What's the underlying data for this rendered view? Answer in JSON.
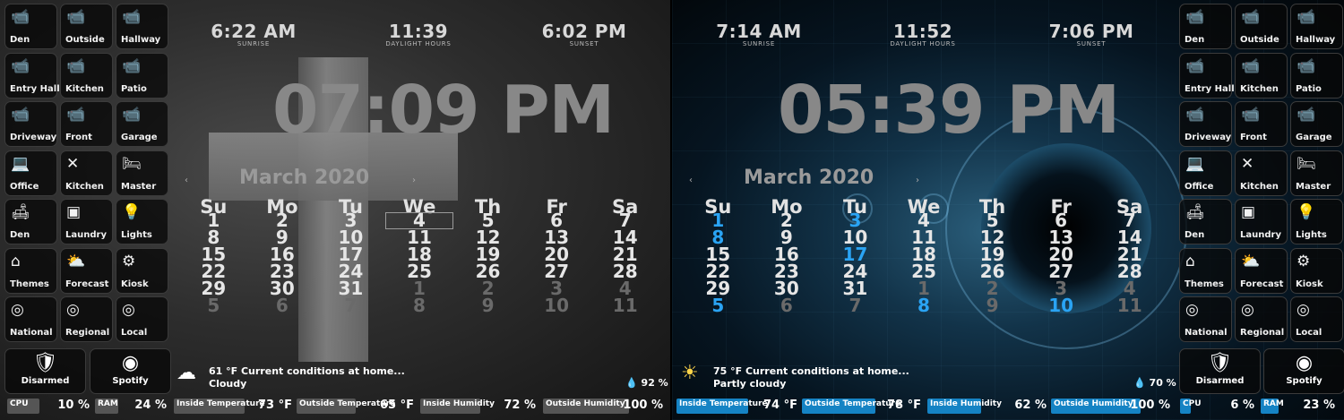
{
  "colors": {
    "accent_blue": "#1583c4",
    "accent_gray": "#555555",
    "today_blue": "#2aa4f4"
  },
  "left": {
    "tiles": [
      {
        "label": "Den",
        "icon": "camera-icon",
        "glyph": "📹"
      },
      {
        "label": "Outside",
        "icon": "camera-icon",
        "glyph": "📹"
      },
      {
        "label": "Hallway",
        "icon": "camera-icon",
        "glyph": "📹"
      },
      {
        "label": "Entry Hall",
        "icon": "camera-icon",
        "glyph": "📹"
      },
      {
        "label": "Kitchen",
        "icon": "camera-icon",
        "glyph": "📹"
      },
      {
        "label": "Patio",
        "icon": "camera-icon",
        "glyph": "📹"
      },
      {
        "label": "Driveway",
        "icon": "camera-icon",
        "glyph": "📹"
      },
      {
        "label": "Front",
        "icon": "camera-icon",
        "glyph": "📹"
      },
      {
        "label": "Garage",
        "icon": "camera-icon",
        "glyph": "📹"
      },
      {
        "label": "Office",
        "icon": "laptop-icon",
        "glyph": "💻"
      },
      {
        "label": "Kitchen",
        "icon": "utensils-icon",
        "glyph": "✕"
      },
      {
        "label": "Master",
        "icon": "bed-icon",
        "glyph": "🛏"
      },
      {
        "label": "Den",
        "icon": "sofa-icon",
        "glyph": "🛋"
      },
      {
        "label": "Laundry",
        "icon": "washer-icon",
        "glyph": "▣"
      },
      {
        "label": "Lights",
        "icon": "lightbulb-icon",
        "glyph": "💡"
      },
      {
        "label": "Themes",
        "icon": "home-palette-icon",
        "glyph": "⌂"
      },
      {
        "label": "Forecast",
        "icon": "weather-icon",
        "glyph": "⛅"
      },
      {
        "label": "Kiosk",
        "icon": "gear-icon",
        "glyph": "⚙"
      },
      {
        "label": "National",
        "icon": "radar-icon",
        "glyph": "◎"
      },
      {
        "label": "Regional",
        "icon": "radar-icon",
        "glyph": "◎"
      },
      {
        "label": "Local",
        "icon": "radar-icon",
        "glyph": "◎"
      }
    ],
    "disarmed": {
      "label": "Disarmed",
      "icon": "shield-check-icon",
      "glyph": "🛡"
    },
    "spotify": {
      "label": "Spotify",
      "icon": "spotify-icon",
      "glyph": "◉"
    },
    "sunrise": {
      "time": "6:22 AM",
      "label": "SUNRISE"
    },
    "daylight": {
      "time": "11:39",
      "label": "DAYLIGHT HOURS"
    },
    "sunset": {
      "time": "6:02 PM",
      "label": "SUNSET"
    },
    "clock": "07:09 PM",
    "calendar": {
      "title": "March 2020",
      "prev": "‹",
      "next": "›",
      "headers": [
        "Su",
        "Mo",
        "Tu",
        "We",
        "Th",
        "Fr",
        "Sa"
      ],
      "days": [
        "1",
        "2",
        "3",
        "4",
        "5",
        "6",
        "7",
        "8",
        "9",
        "10",
        "11",
        "12",
        "13",
        "14",
        "15",
        "16",
        "17",
        "18",
        "19",
        "20",
        "21",
        "22",
        "23",
        "24",
        "25",
        "26",
        "27",
        "28",
        "29",
        "30",
        "31",
        "1",
        "2",
        "3",
        "4",
        "5",
        "6",
        "7",
        "8",
        "9",
        "10",
        "11"
      ]
    },
    "weather": {
      "line1": "61 °F Current conditions at home...",
      "line2": "Cloudy",
      "icon": "cloud-icon",
      "glyph": "☁"
    },
    "humidity": "92 %",
    "status": [
      {
        "label": "CPU",
        "value": "10 %",
        "pct": 8
      },
      {
        "label": "RAM",
        "value": "24 %",
        "pct": 25
      },
      {
        "label": "Inside Temperature",
        "value": "73 °F",
        "pct": 82
      },
      {
        "label": "Outside Temperature",
        "value": "65 °F",
        "pct": 72
      },
      {
        "label": "Inside Humidity",
        "value": "72 %",
        "pct": 70
      },
      {
        "label": "Outside Humidity",
        "value": "100 %",
        "pct": 100
      }
    ]
  },
  "right": {
    "tiles": [
      {
        "label": "Den",
        "icon": "camera-icon",
        "glyph": "📹"
      },
      {
        "label": "Outside",
        "icon": "camera-icon",
        "glyph": "📹"
      },
      {
        "label": "Hallway",
        "icon": "camera-icon",
        "glyph": "📹"
      },
      {
        "label": "Entry Hall",
        "icon": "camera-icon",
        "glyph": "📹"
      },
      {
        "label": "Kitchen",
        "icon": "camera-icon",
        "glyph": "📹"
      },
      {
        "label": "Patio",
        "icon": "camera-icon",
        "glyph": "📹"
      },
      {
        "label": "Driveway",
        "icon": "camera-icon",
        "glyph": "📹"
      },
      {
        "label": "Front",
        "icon": "camera-icon",
        "glyph": "📹"
      },
      {
        "label": "Garage",
        "icon": "camera-icon",
        "glyph": "📹"
      },
      {
        "label": "Office",
        "icon": "laptop-icon",
        "glyph": "💻"
      },
      {
        "label": "Kitchen",
        "icon": "utensils-icon",
        "glyph": "✕"
      },
      {
        "label": "Master",
        "icon": "bed-icon",
        "glyph": "🛏"
      },
      {
        "label": "Den",
        "icon": "sofa-icon",
        "glyph": "🛋"
      },
      {
        "label": "Laundry",
        "icon": "washer-icon",
        "glyph": "▣"
      },
      {
        "label": "Lights",
        "icon": "lightbulb-icon",
        "glyph": "💡"
      },
      {
        "label": "Themes",
        "icon": "home-palette-icon",
        "glyph": "⌂"
      },
      {
        "label": "Forecast",
        "icon": "weather-icon",
        "glyph": "⛅"
      },
      {
        "label": "Kiosk",
        "icon": "gear-icon",
        "glyph": "⚙"
      },
      {
        "label": "National",
        "icon": "radar-icon",
        "glyph": "◎"
      },
      {
        "label": "Regional",
        "icon": "radar-icon",
        "glyph": "◎"
      },
      {
        "label": "Local",
        "icon": "radar-icon",
        "glyph": "◎"
      }
    ],
    "disarmed": {
      "label": "Disarmed",
      "icon": "shield-check-icon",
      "glyph": "🛡"
    },
    "spotify": {
      "label": "Spotify",
      "icon": "spotify-icon",
      "glyph": "◉"
    },
    "sunrise": {
      "time": "7:14 AM",
      "label": "SUNRISE"
    },
    "daylight": {
      "time": "11:52",
      "label": "DAYLIGHT HOURS"
    },
    "sunset": {
      "time": "7:06 PM",
      "label": "SUNSET"
    },
    "clock": "05:39 PM",
    "calendar": {
      "title": "March 2020",
      "prev": "‹",
      "next": "›",
      "headers": [
        "Su",
        "Mo",
        "Tu",
        "We",
        "Th",
        "Fr",
        "Sa"
      ],
      "days": [
        "1",
        "2",
        "3",
        "4",
        "5",
        "6",
        "7",
        "8",
        "9",
        "10",
        "11",
        "12",
        "13",
        "14",
        "15",
        "16",
        "17",
        "18",
        "19",
        "20",
        "21",
        "22",
        "23",
        "24",
        "25",
        "26",
        "27",
        "28",
        "29",
        "30",
        "31",
        "1",
        "2",
        "3",
        "4",
        "5",
        "6",
        "7",
        "8",
        "9",
        "10",
        "11"
      ]
    },
    "weather": {
      "line1": "75 °F Current conditions at home...",
      "line2": "Partly cloudy",
      "icon": "partly-cloudy-icon",
      "glyph": "☀"
    },
    "humidity": "70 %",
    "status": [
      {
        "label": "Inside Temperature",
        "value": "74 °F",
        "pct": 80
      },
      {
        "label": "Outside Temperature",
        "value": "78 °F",
        "pct": 82
      },
      {
        "label": "Inside Humidity",
        "value": "62 %",
        "pct": 60
      },
      {
        "label": "Outside Humidity",
        "value": "100 %",
        "pct": 100
      },
      {
        "label": "CPU",
        "value": "6 %",
        "pct": 6
      },
      {
        "label": "RAM",
        "value": "23 %",
        "pct": 30
      }
    ]
  }
}
